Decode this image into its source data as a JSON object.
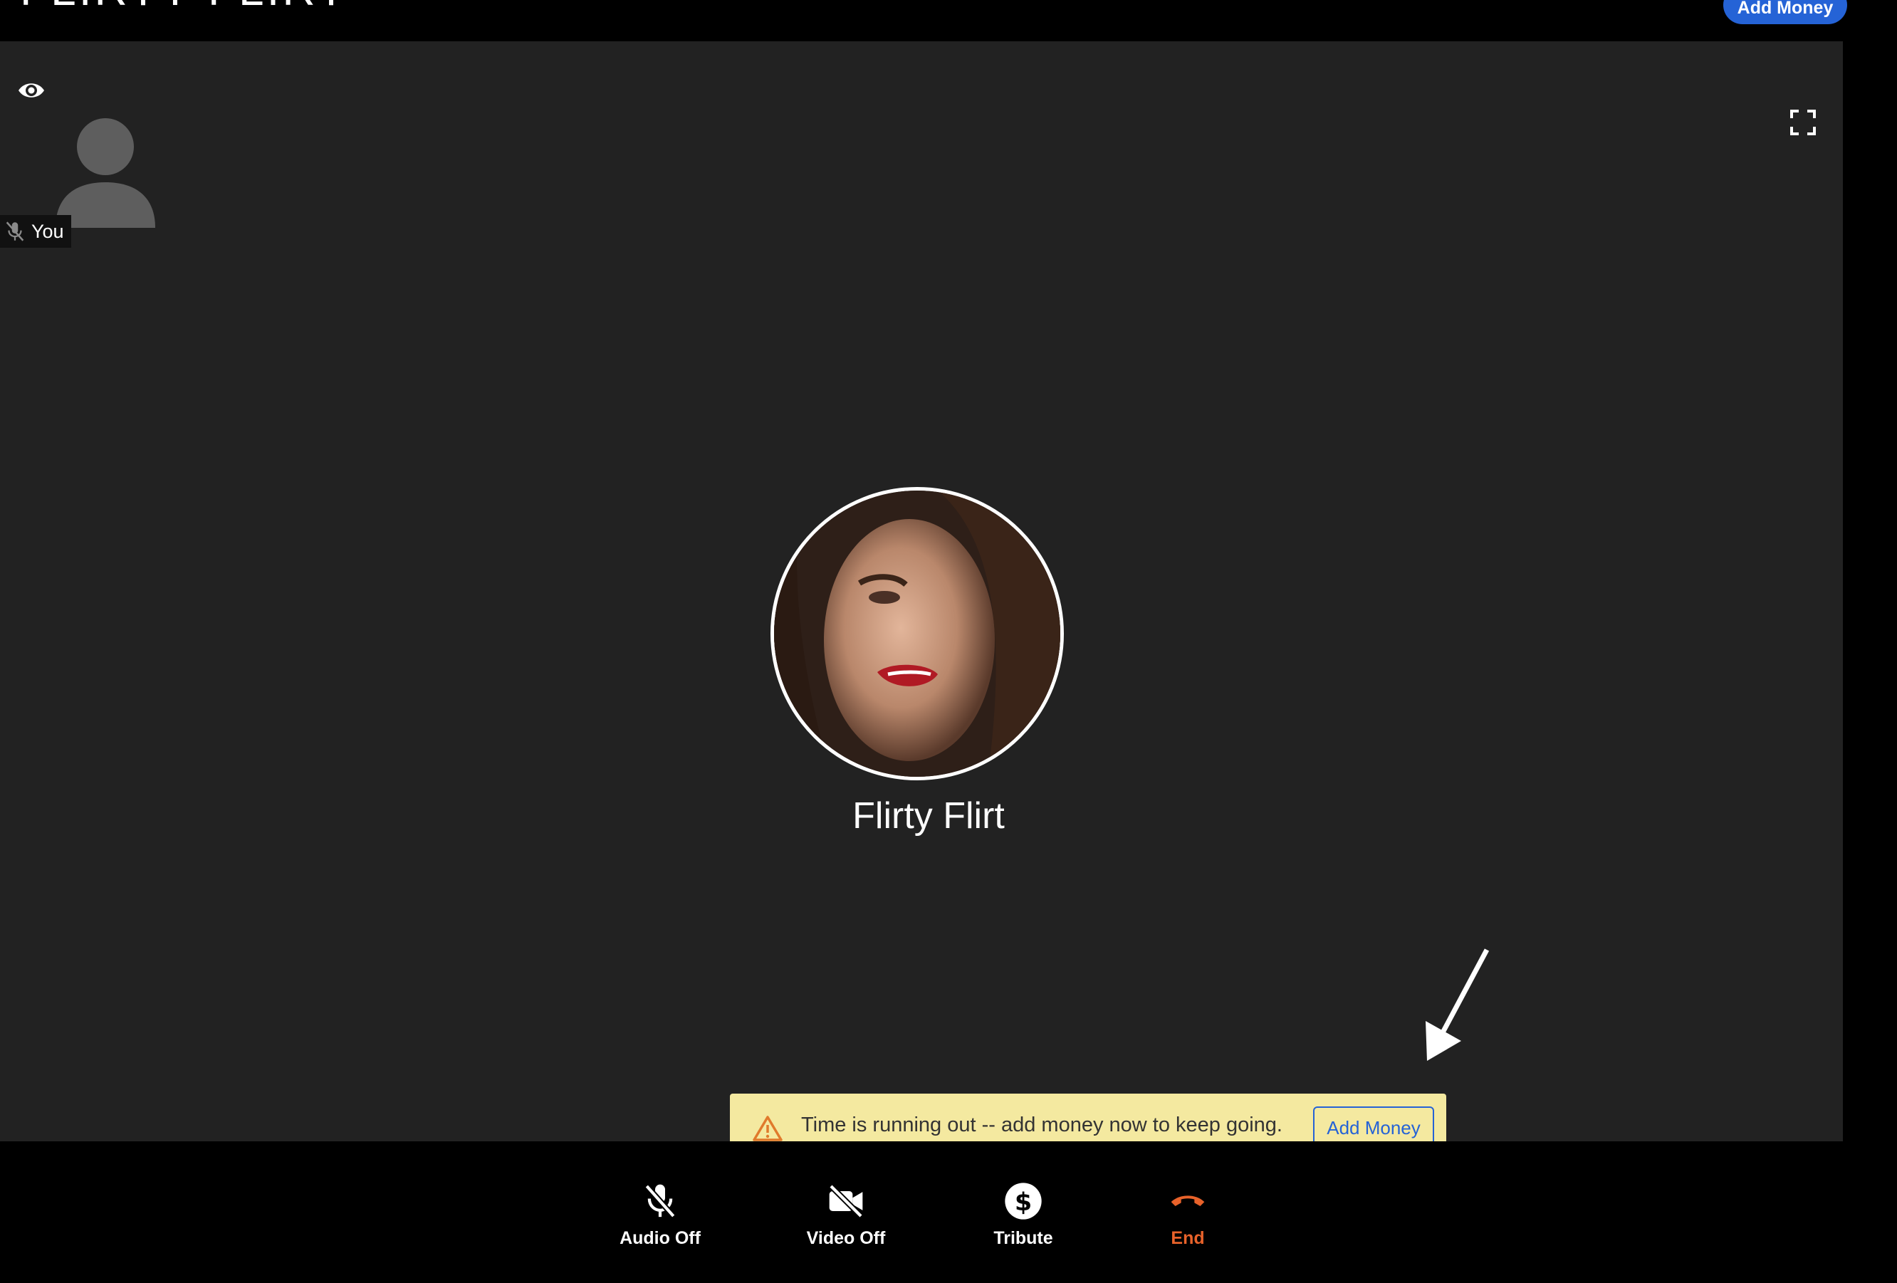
{
  "header": {
    "brand_text": "FLIRTY FLIRT",
    "add_money_label": "Add Money"
  },
  "stage": {
    "self": {
      "label": "You",
      "muted_icon": "mic-off-icon",
      "avatar_icon": "person-icon"
    },
    "view_icon": "eye-icon",
    "fullscreen_icon": "fullscreen-icon",
    "remote": {
      "name": "Flirty Flirt"
    }
  },
  "banner": {
    "icon": "warning-icon",
    "message": "Time is running out -- add money now to keep going.",
    "button_label": "Add Money"
  },
  "controls": [
    {
      "label": "Audio Off",
      "icon": "mic-off-icon"
    },
    {
      "label": "Video Off",
      "icon": "video-off-icon"
    },
    {
      "label": "Tribute",
      "icon": "dollar-icon"
    },
    {
      "label": "End",
      "icon": "hang-up-icon"
    }
  ],
  "colors": {
    "accent": "#2563d6",
    "banner_bg": "#f4e9a0",
    "end": "#e8622a",
    "stage_bg": "#222222"
  }
}
